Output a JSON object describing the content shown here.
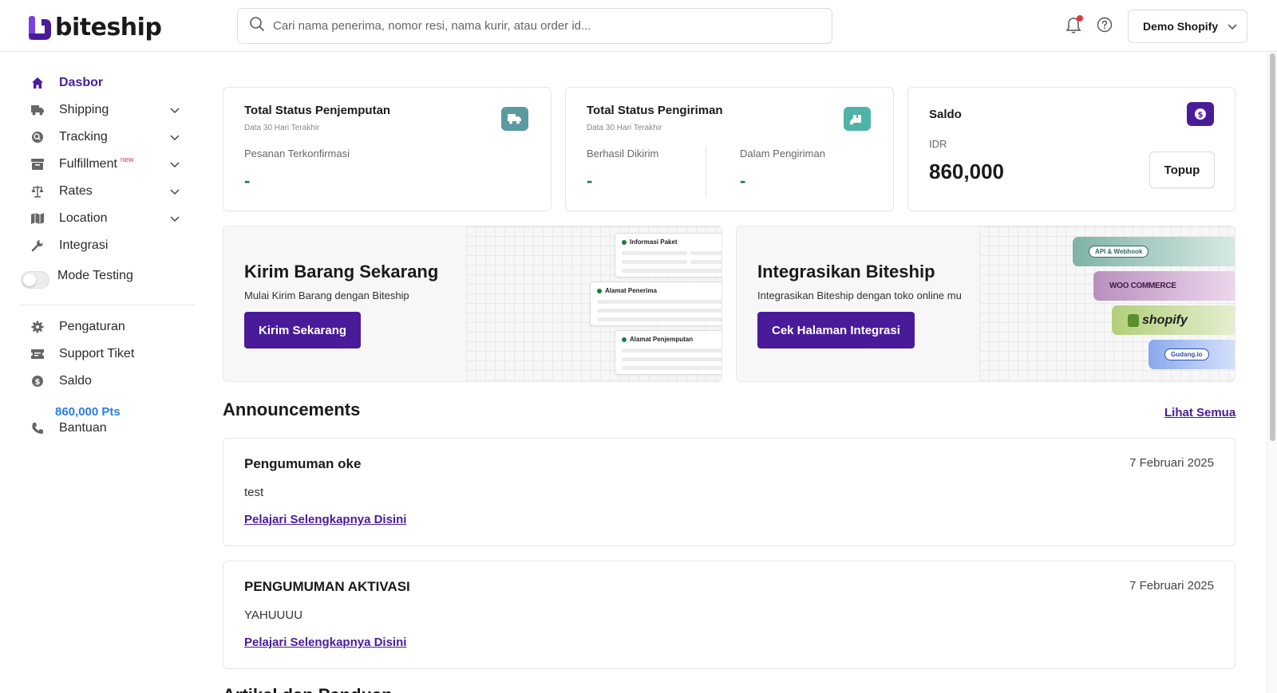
{
  "brand": {
    "name": "biteship",
    "accent": "#4a1b99",
    "logo_icon": "biteship-logo-icon"
  },
  "header": {
    "search_placeholder": "Cari nama penerima, nomor resi, nama kurir, atau order id...",
    "account_label": "Demo Shopify"
  },
  "sidebar": {
    "items": [
      {
        "label": "Dasbor",
        "icon": "home-icon"
      },
      {
        "label": "Shipping",
        "icon": "truck-icon"
      },
      {
        "label": "Tracking",
        "icon": "tracking-icon"
      },
      {
        "label": "Fulfillment",
        "icon": "archive-box-icon",
        "badge": "new"
      },
      {
        "label": "Rates",
        "icon": "scale-icon"
      },
      {
        "label": "Location",
        "icon": "map-icon"
      },
      {
        "label": "Integrasi",
        "icon": "wrench-icon"
      },
      {
        "label": "Mode Testing"
      },
      {
        "label": "Pengaturan",
        "icon": "gear-icon"
      },
      {
        "label": "Support Tiket",
        "icon": "ticket-icon"
      },
      {
        "label": "Saldo",
        "icon": "dollar-circle-icon"
      },
      {
        "label": "Bantuan",
        "icon": "phone-icon"
      }
    ],
    "points": "860,000 Pts"
  },
  "stats": {
    "pickup": {
      "title": "Total Status Penjemputan",
      "subtitle": "Data 30 Hari Terakhir",
      "label": "Pesanan Terkonfirmasi",
      "value": "-"
    },
    "shipping": {
      "title": "Total Status Pengiriman",
      "subtitle": "Data 30 Hari Terakhir",
      "label1": "Berhasil Dikirim",
      "value1": "-",
      "label2": "Dalam Pengiriman",
      "value2": "-"
    },
    "balance": {
      "title": "Saldo",
      "currency": "IDR",
      "amount": "860,000",
      "button": "Topup"
    }
  },
  "banners": {
    "ship": {
      "title": "Kirim Barang Sekarang",
      "subtitle": "Mulai Kirim Barang dengan Biteship",
      "button": "Kirim Sekarang",
      "cards": [
        "Informasi Paket",
        "Alamat Penerima",
        "Alamat Penjemputan"
      ]
    },
    "integrate": {
      "title": "Integrasikan Biteship",
      "subtitle": "Integrasikan Biteship dengan toko online mu",
      "button": "Cek Halaman Integrasi",
      "logos": [
        "API & Webhook",
        "WOO COMMERCE",
        "shopify",
        "Gudang.io"
      ]
    }
  },
  "announcements": {
    "heading": "Announcements",
    "see_all": "Lihat Semua",
    "items": [
      {
        "title": "Pengumuman oke",
        "date": "7 Februari 2025",
        "body": "test",
        "link": "Pelajari Selengkapnya Disini"
      },
      {
        "title": "PENGUMUMAN AKTIVASI",
        "date": "7 Februari 2025",
        "body": "YAHUUUU",
        "link": "Pelajari Selengkapnya Disini"
      }
    ]
  },
  "next_section_heading": "Artikel dan Panduan"
}
